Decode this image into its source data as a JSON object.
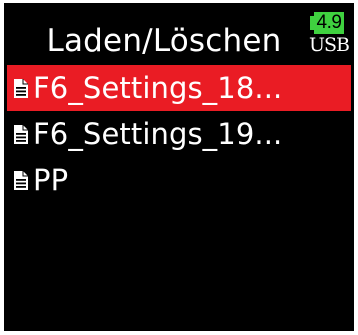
{
  "header": {
    "title": "Laden/Löschen",
    "battery_level": "4.9",
    "power_source": "USB"
  },
  "files": [
    {
      "name": "F6_Settings_18...",
      "selected": true
    },
    {
      "name": "F6_Settings_19...",
      "selected": false
    },
    {
      "name": "PP",
      "selected": false
    }
  ],
  "colors": {
    "background": "#000000",
    "selection": "#ea1c24",
    "battery": "#3fd13f",
    "text": "#ffffff"
  },
  "icons": {
    "file": "document-icon",
    "battery": "battery-icon"
  }
}
